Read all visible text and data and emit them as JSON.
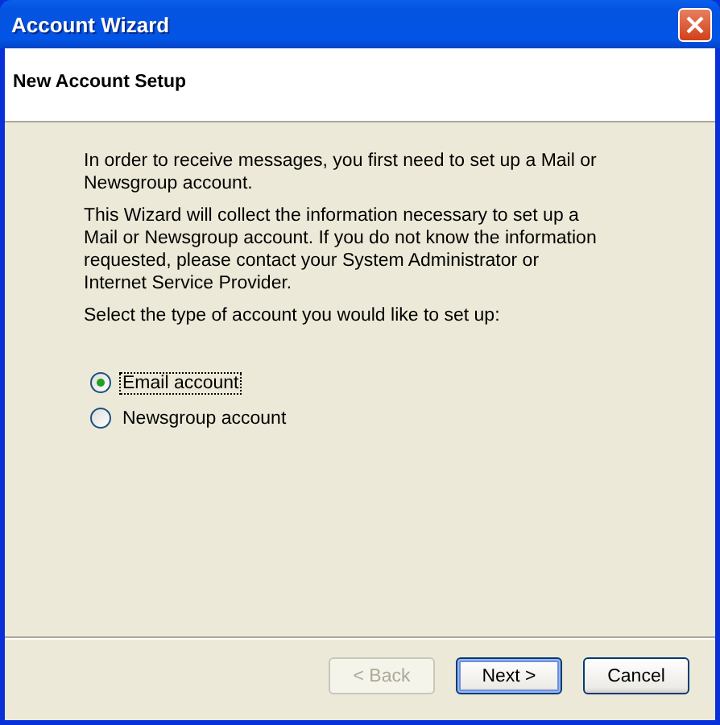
{
  "window": {
    "title": "Account Wizard"
  },
  "header": {
    "title": "New Account Setup"
  },
  "paragraphs": [
    "In order to receive messages, you first need to set up a Mail or Newsgroup account.",
    "This Wizard will collect the information necessary to set up a Mail or Newsgroup account. If you do not know the information requested, please contact your System Administrator or Internet Service Provider.",
    "Select the type of account you would like to set up:"
  ],
  "account_types": [
    {
      "label": "Email account",
      "selected": true
    },
    {
      "label": "Newsgroup account",
      "selected": false
    }
  ],
  "buttons": [
    {
      "label": "< Back",
      "disabled": true,
      "default": false
    },
    {
      "label": "Next >",
      "disabled": false,
      "default": true
    },
    {
      "label": "Cancel",
      "disabled": false,
      "default": false
    }
  ]
}
